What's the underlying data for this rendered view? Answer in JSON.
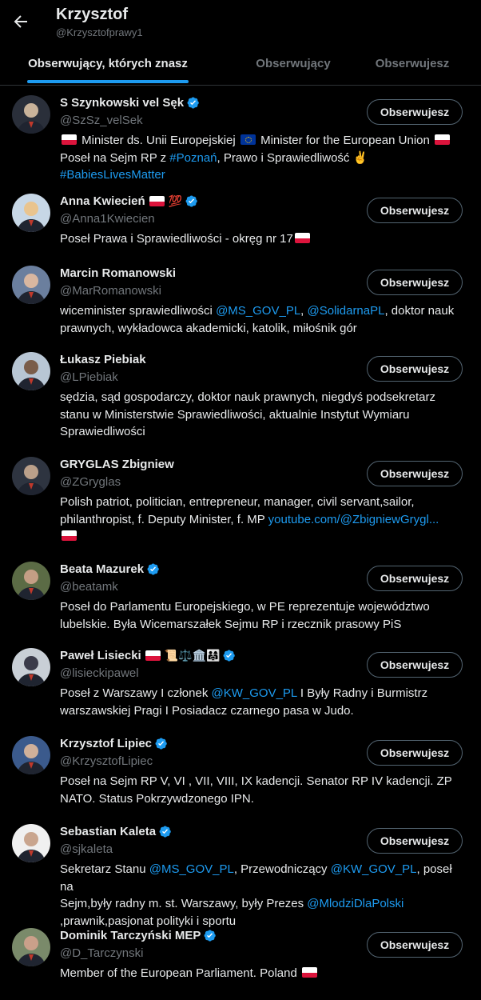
{
  "header": {
    "name": "Krzysztof",
    "handle": "@Krzysztofprawy1"
  },
  "tabs": [
    {
      "label": "Obserwujący, których znasz",
      "active": true
    },
    {
      "label": "Obserwujący",
      "active": false
    },
    {
      "label": "Obserwujesz",
      "active": false
    }
  ],
  "colors": {
    "accent": "#1d9bf0",
    "background": "#000000",
    "muted": "#71767b"
  },
  "users": [
    {
      "name": "S Szynkowski vel Sęk",
      "handle": "@SzSz_velSek",
      "button": "Obserwujesz",
      "verified": true,
      "bio": [
        [
          "flag-pl",
          " Minister ds. Unii Europejskiej ",
          "flag-eu",
          " Minister for the European Union ",
          "flag-pl"
        ],
        [
          "Poseł na Sejm RP z ",
          {
            "link": "#Poznań"
          },
          ", Prawo i Sprawiedliwość ✌️"
        ],
        [
          {
            "link": "#BabiesLivesMatter"
          }
        ]
      ]
    },
    {
      "name": "Anna Kwiecień",
      "name_suffix": [
        "flag-pl",
        "💯"
      ],
      "handle": "@Anna1Kwiecien",
      "button": "Obserwujesz",
      "verified": true,
      "bio": [
        [
          "Poseł Prawa i Sprawiedliwości - okręg nr 17",
          "flag-pl"
        ]
      ]
    },
    {
      "name": "Marcin Romanowski",
      "handle": "@MarRomanowski",
      "button": "Obserwujesz",
      "verified": false,
      "bio": [
        [
          "wiceminister sprawiedliwości ",
          {
            "link": "@MS_GOV_PL"
          },
          ", ",
          {
            "link": "@SolidarnaPL"
          },
          ", doktor nauk"
        ],
        [
          "prawnych, wykładowca akademicki, katolik, miłośnik gór"
        ]
      ]
    },
    {
      "name": "Łukasz Piebiak",
      "handle": "@LPiebiak",
      "button": "Obserwujesz",
      "verified": false,
      "bio": [
        [
          "sędzia, sąd gospodarczy, doktor nauk prawnych, niegdyś podsekretarz"
        ],
        [
          "stanu w Ministerstwie Sprawiedliwości, aktualnie Instytut Wymiaru"
        ],
        [
          "Sprawiedliwości"
        ]
      ]
    },
    {
      "name": "GRYGLAS Zbigniew",
      "handle": "@ZGryglas",
      "button": "Obserwujesz",
      "verified": false,
      "bio": [
        [
          "Polish patriot, politician, entrepreneur, manager, civil servant,sailor,"
        ],
        [
          "philanthropist, f. Deputy Minister, f. MP ",
          {
            "link": "youtube.com/@ZbigniewGrygl..."
          }
        ],
        [
          "flag-pl"
        ]
      ]
    },
    {
      "name": "Beata Mazurek",
      "handle": "@beatamk",
      "button": "Obserwujesz",
      "verified": true,
      "bio": [
        [
          "Poseł do Parlamentu Europejskiego, w PE reprezentuje województwo"
        ],
        [
          "lubelskie. Była Wicemarszałek Sejmu RP i rzecznik prasowy PiS"
        ]
      ]
    },
    {
      "name": "Paweł Lisiecki",
      "name_suffix": [
        "flag-pl",
        "📜⚖️🏛️👨‍👩‍👧"
      ],
      "handle": "@lisieckipawel",
      "button": "Obserwujesz",
      "verified": true,
      "bio": [
        [
          "Poseł z Warszawy I członek ",
          {
            "link": "@KW_GOV_PL"
          },
          " I Były Radny i Burmistrz"
        ],
        [
          "warszawskiej Pragi I Posiadacz czarnego pasa w Judo."
        ]
      ]
    },
    {
      "name": "Krzysztof Lipiec",
      "handle": "@KrzysztofLipiec",
      "button": "Obserwujesz",
      "verified": true,
      "bio": [
        [
          "Poseł na Sejm RP V, VI , VII, VIII, IX kadencji. Senator RP IV kadencji. ZP"
        ],
        [
          "NATO. Status Pokrzywdzonego IPN."
        ]
      ]
    },
    {
      "name": "Sebastian Kaleta",
      "handle": "@sjkaleta",
      "button": "Obserwujesz",
      "verified": true,
      "bio": [
        [
          "Sekretarz Stanu ",
          {
            "link": "@MS_GOV_PL"
          },
          ", Przewodniczący ",
          {
            "link": "@KW_GOV_PL"
          },
          ", poseł na"
        ],
        [
          "Sejm,były radny m. st. Warszawy, były Prezes ",
          {
            "link": "@MlodziDlaPolski"
          }
        ],
        [
          ",prawnik,pasjonat polityki i sportu"
        ]
      ]
    },
    {
      "name": "Dominik Tarczyński MEP",
      "handle": "@D_Tarczynski",
      "button": "Obserwujesz",
      "verified": true,
      "bio": [
        [
          "Member of the European Parliament. Poland ",
          "flag-pl"
        ]
      ]
    }
  ]
}
